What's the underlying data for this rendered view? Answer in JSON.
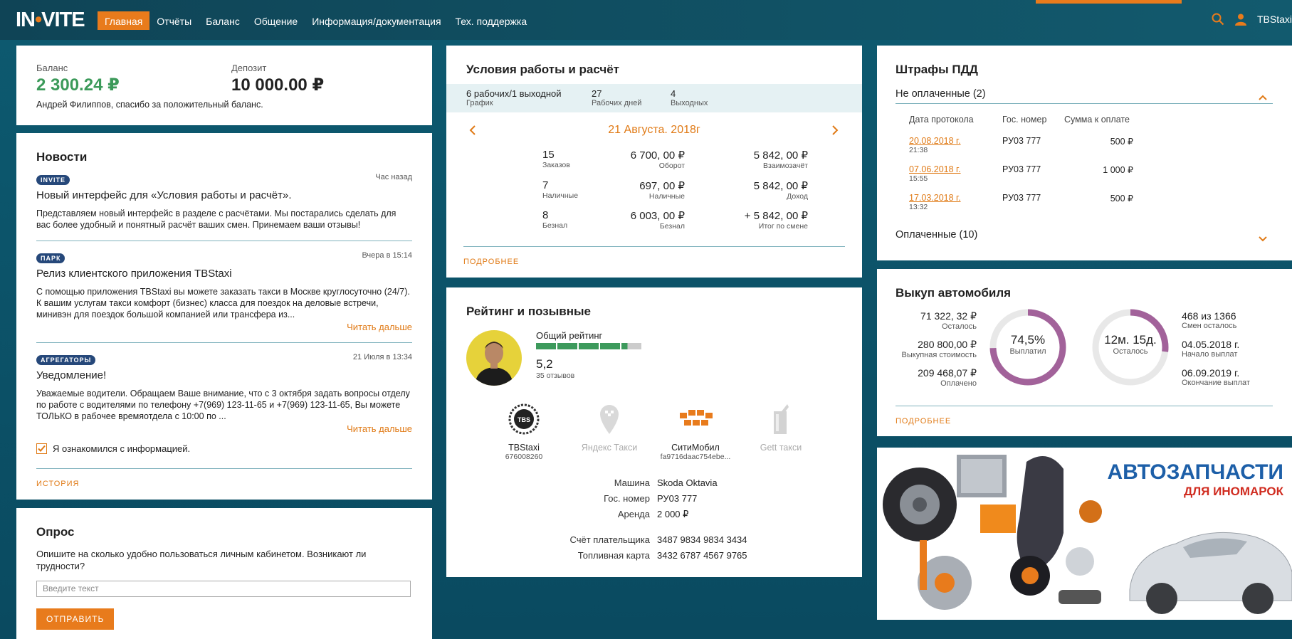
{
  "header": {
    "logo": "INVITE",
    "nav": [
      "Главная",
      "Отчёты",
      "Баланс",
      "Общение",
      "Информация/документация",
      "Тех. поддержка"
    ],
    "active_nav": 0,
    "user": "TBStaxi"
  },
  "balance": {
    "balance_label": "Баланс",
    "balance_value": "2 300.24 ₽",
    "deposit_label": "Депозит",
    "deposit_value": "10 000.00 ₽",
    "message": "Андрей Филиппов, спасибо за положительный баланс."
  },
  "news": {
    "title": "Новости",
    "items": [
      {
        "badge": "INVITE",
        "time": "Час назад",
        "title": "Новый интерфейс для «Условия работы и расчёт».",
        "text": "Представляем новый интерфейс в разделе с расчётами. Мы постарались сделать для вас более удобный и понятный расчёт ваших смен. Принемаем ваши отзывы!",
        "readmore": ""
      },
      {
        "badge": "ПАРК",
        "time": "Вчера в 15:14",
        "title": "Релиз клиентского приложения TBStaxi",
        "text": "С помощью приложения TBStaxi вы можете заказать такси в Москве круглосуточно (24/7). К вашим услугам такси комфорт (бизнес) класса для поездок на деловые встречи, минивэн для поездок большой компанией или трансфера из...",
        "readmore": "Читать дальше"
      },
      {
        "badge": "АГРЕГАТОРЫ",
        "time": "21 Июля в 13:34",
        "title": "Уведомление!",
        "text": "Уважаемые водители.   Обращаем Ваше внимание, что с 3 октября задать вопросы отделу по работе с водителями по телефону +7(969) 123-11-65 и +7(969) 123-11-65, Вы можете ТОЛЬКО в рабочее времяотдела с 10:00 по ...",
        "readmore": "Читать дальше"
      }
    ],
    "ack_label": "Я ознакомился с информацией.",
    "ack_checked": true,
    "history": "ИСТОРИЯ"
  },
  "poll": {
    "title": "Опрос",
    "question": "Опишите на сколько удобно пользоваться личным кабинетом. Возникают ли трудности?",
    "placeholder": "Введите текст",
    "submit": "ОТПРАВИТЬ"
  },
  "conditions": {
    "title": "Условия работы и расчёт",
    "schedule_value": "6 рабочих/1 выходной",
    "schedule_label": "График",
    "work_days_value": "27",
    "work_days_label": "Рабочих дней",
    "days_off_value": "4",
    "days_off_label": "Выходных",
    "date": "21 Августа. 2018г",
    "rows": [
      [
        {
          "v": "15",
          "l": "Заказов"
        },
        {
          "v": "6 700, 00 ₽",
          "l": "Оборот"
        },
        {
          "v": "5 842, 00 ₽",
          "l": "Взаимозачёт"
        }
      ],
      [
        {
          "v": "7",
          "l": "Наличные"
        },
        {
          "v": "697, 00 ₽",
          "l": "Наличные"
        },
        {
          "v": "5 842, 00 ₽",
          "l": "Доход"
        }
      ],
      [
        {
          "v": "8",
          "l": "Безнал"
        },
        {
          "v": "6 003, 00 ₽",
          "l": "Безнал"
        },
        {
          "v": "+ 5 842, 00 ₽",
          "l": "Итог по смене"
        }
      ]
    ],
    "more": "ПОДРОБНЕЕ"
  },
  "rating": {
    "title": "Рейтинг и позывные",
    "overall_label": "Общий рейтинг",
    "score": "5,2",
    "reviews": "35 отзывов",
    "rating_fraction": 0.84,
    "services": [
      {
        "name": "TBStaxi",
        "sub": "676008260",
        "active": true
      },
      {
        "name": "Яндекс Такси",
        "sub": "",
        "active": false
      },
      {
        "name": "СитиМобил",
        "sub": "fa9716daac754ebe...",
        "active": true
      },
      {
        "name": "Gett такси",
        "sub": "",
        "active": false
      }
    ],
    "details": [
      {
        "k": "Машина",
        "v": "Skoda Oktavia"
      },
      {
        "k": "Гос. номер",
        "v": "РУ03 777"
      },
      {
        "k": "Аренда",
        "v": "2 000 ₽"
      }
    ],
    "details2": [
      {
        "k": "Счёт плательщика",
        "v": "3487 9834 9834 3434"
      },
      {
        "k": "Топливная карта",
        "v": "3432 6787 4567 9765"
      }
    ]
  },
  "fines": {
    "title": "Штрафы ПДД",
    "unpaid_label": "Не оплаченные (2)",
    "columns": [
      "Дата протокола",
      "Гос. номер",
      "Сумма к оплате"
    ],
    "rows": [
      {
        "date": "20.08.2018 г.",
        "time": "21:38",
        "plate": "РУ03 777",
        "sum": "500 ₽"
      },
      {
        "date": "07.06.2018 г.",
        "time": "15:55",
        "plate": "РУ03 777",
        "sum": "1 000 ₽"
      },
      {
        "date": "17.03.2018 г.",
        "time": "13:32",
        "plate": "РУ03 777",
        "sum": "500 ₽"
      }
    ],
    "paid_label": "Оплаченные (10)"
  },
  "buyout": {
    "title": "Выкуп автомобиля",
    "left": [
      {
        "v": "71 322, 32 ₽",
        "l": "Осталось"
      },
      {
        "v": "280 800,00 ₽",
        "l": "Выкупная стоимость"
      },
      {
        "v": "209 468,07 ₽",
        "l": "Оплачено"
      }
    ],
    "ring1_value": "74,5%",
    "ring1_label": "Выплатил",
    "ring1_fraction": 0.745,
    "ring2_value": "12м. 15д.",
    "ring2_label": "Осталось",
    "ring2_fraction": 0.27,
    "right": [
      {
        "v": "468 из 1366",
        "l": "Смен осталось"
      },
      {
        "v": "04.05.2018 г.",
        "l": "Начало выплат"
      },
      {
        "v": "06.09.2019 г.",
        "l": "Окончание выплат"
      }
    ],
    "more": "ПОДРОБНЕЕ"
  },
  "ad": {
    "headline": "АВТОЗАПЧАСТИ",
    "sub": "ДЛЯ ИНОМАРОК"
  },
  "colors": {
    "accent": "#e87b1c",
    "balance_green": "#3c9a5a",
    "rating_green": "#3d9a5c",
    "ring_purple": "#a2629a",
    "badge_blue": "#26487a"
  }
}
